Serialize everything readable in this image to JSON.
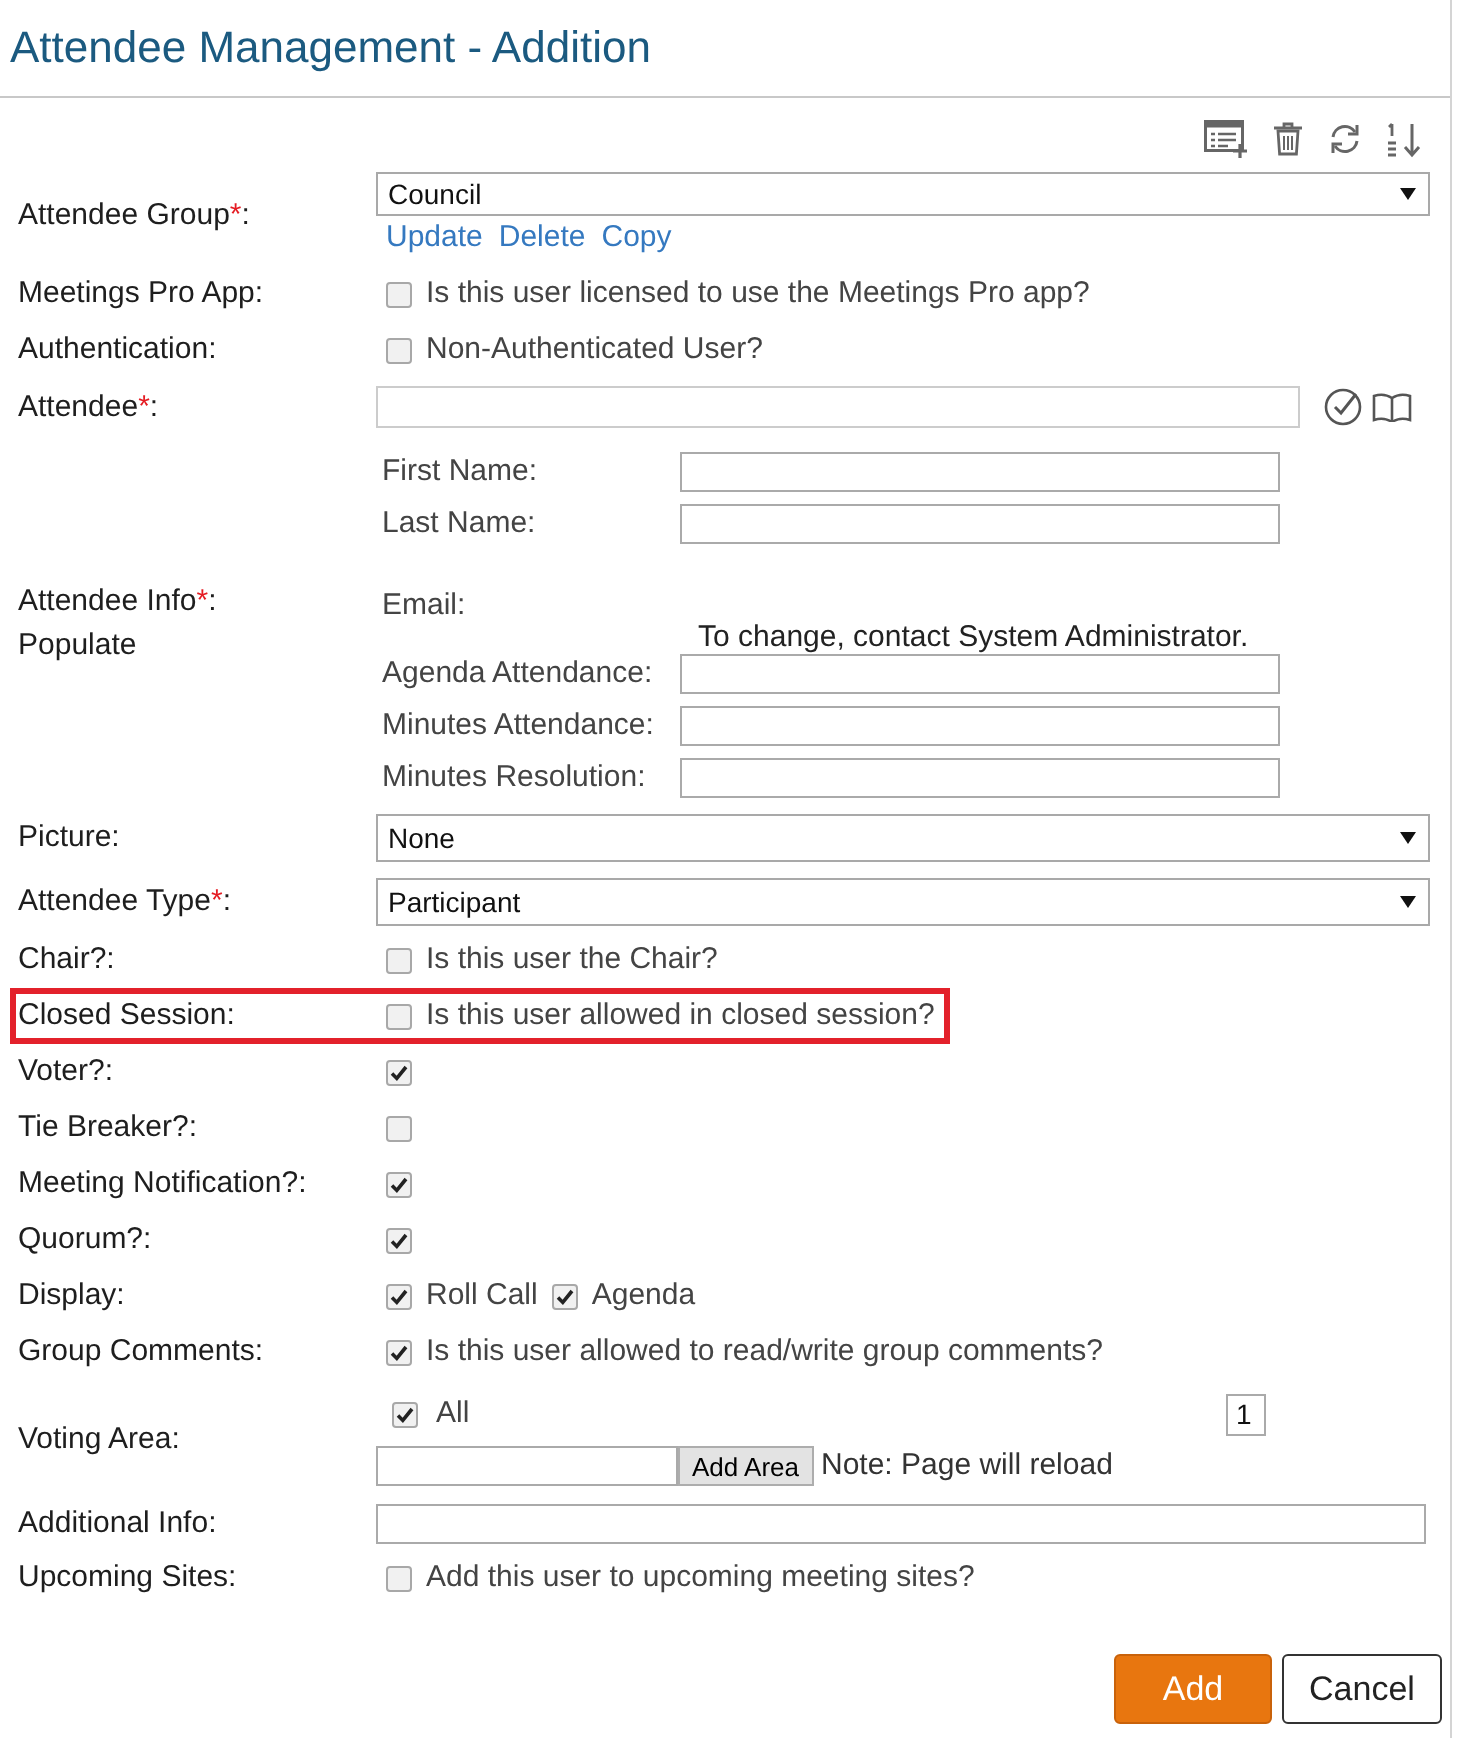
{
  "title": "Attendee Management - Addition",
  "form": [
    {
      "kind": "select",
      "label": "Attendee Group",
      "required": "*",
      "suffix": ":",
      "highlighted": false,
      "value": "Council",
      "links": [
        "Update",
        "Delete",
        "Copy"
      ]
    },
    {
      "kind": "checkbox",
      "label": "Meetings Pro App:",
      "highlighted": false,
      "options": [
        {
          "text": "Is this user licensed to use the Meetings Pro app?",
          "checked": false
        }
      ]
    },
    {
      "kind": "checkbox",
      "label": "Authentication:",
      "highlighted": false,
      "options": [
        {
          "text": "Non-Authenticated User?",
          "checked": false
        }
      ]
    },
    {
      "kind": "lookup",
      "label": "Attendee",
      "required": "*",
      "suffix": ":",
      "highlighted": false,
      "subfields": [
        {
          "label": "First Name:"
        },
        {
          "label": "Last Name:"
        }
      ]
    },
    {
      "kind": "info",
      "label": "Attendee Info",
      "required": "*",
      "suffix": ":",
      "sublabel": "Populate",
      "highlighted": false,
      "email_label": "Email:",
      "note": "To change, contact System Administrator.",
      "subfields": [
        {
          "label": "Agenda Attendance:"
        },
        {
          "label": "Minutes Attendance:"
        },
        {
          "label": "Minutes Resolution:"
        }
      ]
    },
    {
      "kind": "select",
      "label": "Picture:",
      "highlighted": false,
      "value": "None"
    },
    {
      "kind": "select",
      "label": "Attendee Type",
      "required": "*",
      "suffix": ":",
      "highlighted": false,
      "value": "Participant"
    },
    {
      "kind": "checkbox",
      "label": "Chair?:",
      "highlighted": false,
      "options": [
        {
          "text": "Is this user the Chair?",
          "checked": false
        }
      ]
    },
    {
      "kind": "checkbox",
      "label": "Closed Session:",
      "highlighted": true,
      "options": [
        {
          "text": "Is this user allowed in closed session?",
          "checked": false
        }
      ]
    },
    {
      "kind": "checkbox",
      "label": "Voter?:",
      "highlighted": false,
      "options": [
        {
          "checked": true
        }
      ]
    },
    {
      "kind": "checkbox",
      "label": "Tie Breaker?:",
      "highlighted": false,
      "options": [
        {
          "checked": false
        }
      ]
    },
    {
      "kind": "checkbox",
      "label": "Meeting Notification?:",
      "highlighted": false,
      "options": [
        {
          "checked": true
        }
      ]
    },
    {
      "kind": "checkbox",
      "label": "Quorum?:",
      "highlighted": false,
      "options": [
        {
          "checked": true
        }
      ]
    },
    {
      "kind": "checkbox",
      "label": "Display:",
      "highlighted": false,
      "options": [
        {
          "text": "Roll Call",
          "checked": true
        },
        {
          "text": "Agenda",
          "checked": true
        }
      ]
    },
    {
      "kind": "checkbox",
      "label": "Group Comments:",
      "highlighted": false,
      "options": [
        {
          "text": "Is this user allowed to read/write group comments?",
          "checked": true
        }
      ]
    },
    {
      "kind": "voting",
      "label": "Voting Area:",
      "highlighted": false,
      "all": {
        "text": "All",
        "checked": true
      },
      "count": "1",
      "button": "Add Area",
      "note": "Note: Page will reload"
    },
    {
      "kind": "text",
      "label": "Additional Info:",
      "highlighted": false
    },
    {
      "kind": "checkbox",
      "label": "Upcoming Sites:",
      "highlighted": false,
      "options": [
        {
          "text": "Add this user to upcoming meeting sites?",
          "checked": false
        }
      ]
    }
  ],
  "buttons": [
    {
      "label": "Add",
      "kind": "primary"
    },
    {
      "label": "Cancel",
      "kind": "secondary"
    }
  ]
}
